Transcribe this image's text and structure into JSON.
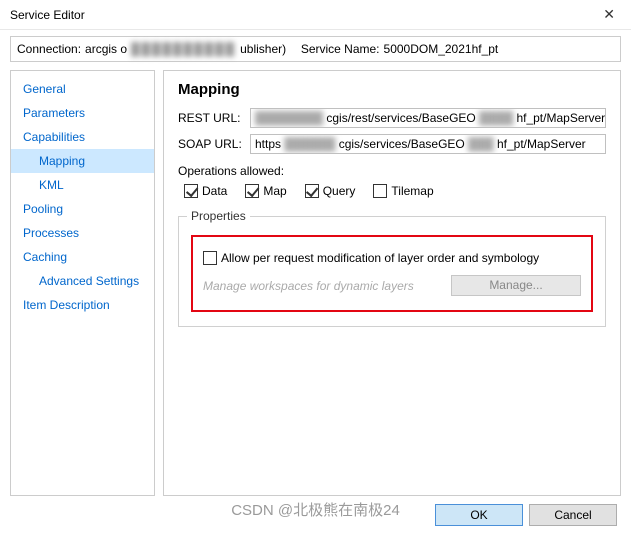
{
  "titlebar": {
    "title": "Service Editor"
  },
  "connection": {
    "label": "Connection:",
    "value_prefix": "arcgis o",
    "value_suffix": "ublisher)",
    "service_name_label": "Service Name:",
    "service_name_value": "5000DOM_2021hf_pt"
  },
  "sidebar": {
    "items": [
      {
        "label": "General",
        "level": 1,
        "selected": false
      },
      {
        "label": "Parameters",
        "level": 1,
        "selected": false
      },
      {
        "label": "Capabilities",
        "level": 1,
        "selected": false
      },
      {
        "label": "Mapping",
        "level": 2,
        "selected": true
      },
      {
        "label": "KML",
        "level": 2,
        "selected": false
      },
      {
        "label": "Pooling",
        "level": 1,
        "selected": false
      },
      {
        "label": "Processes",
        "level": 1,
        "selected": false
      },
      {
        "label": "Caching",
        "level": 1,
        "selected": false
      },
      {
        "label": "Advanced Settings",
        "level": 3,
        "selected": false
      },
      {
        "label": "Item Description",
        "level": 1,
        "selected": false
      }
    ]
  },
  "main": {
    "heading": "Mapping",
    "rest_label": "REST URL:",
    "rest_value_mid": "cgis/rest/services/BaseGEO",
    "rest_value_end": "hf_pt/MapServer",
    "soap_label": "SOAP URL:",
    "soap_value_start": "https",
    "soap_value_mid": "cgis/services/BaseGEO",
    "soap_value_end": "hf_pt/MapServer",
    "ops_label": "Operations allowed:",
    "ops": {
      "data": {
        "label": "Data",
        "checked": true
      },
      "map": {
        "label": "Map",
        "checked": true
      },
      "query": {
        "label": "Query",
        "checked": true
      },
      "tilemap": {
        "label": "Tilemap",
        "checked": false
      }
    },
    "properties": {
      "legend": "Properties",
      "allow_label": "Allow per request modification of layer order and symbology",
      "allow_checked": false,
      "manage_label": "Manage workspaces for dynamic layers",
      "manage_button": "Manage..."
    }
  },
  "footer": {
    "ok": "OK",
    "cancel": "Cancel"
  },
  "watermark": "CSDN @北极熊在南极24"
}
